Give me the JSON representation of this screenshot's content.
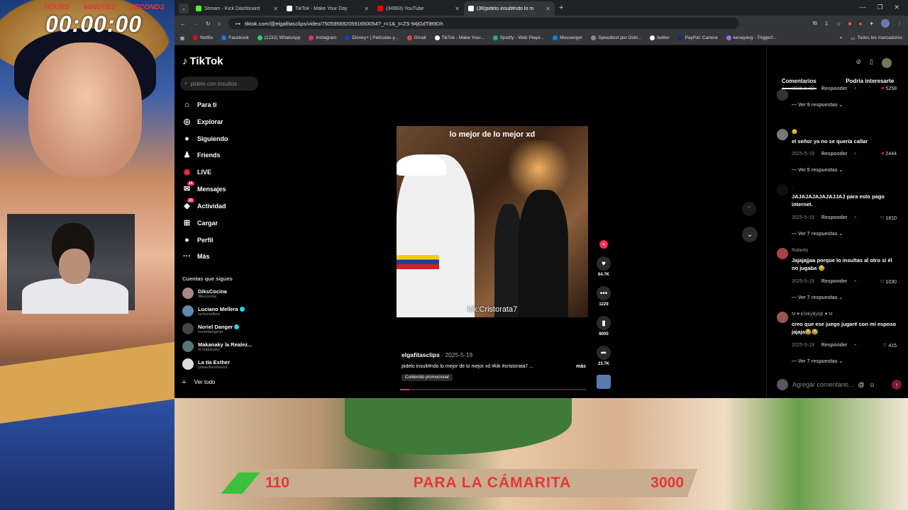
{
  "overlay": {
    "timer_labels": {
      "hours": "HOURS",
      "minutes": "MINUTES",
      "seconds": "SECONDS"
    },
    "timer": "00:00:00",
    "goal": {
      "current": "110",
      "label": "PARA LA CÁMARITA",
      "target": "3000"
    }
  },
  "browser": {
    "tabs": [
      {
        "label": "Stream - Kick Dashboard",
        "color": "#53fc18"
      },
      {
        "label": "TikTok - Make Your Day",
        "color": "#ffffff"
      },
      {
        "label": "(34993) YouTube",
        "color": "#ff0000"
      },
      {
        "label": "(38)pidelo insult#ndo lo m",
        "color": "#ffffff"
      }
    ],
    "url": "tiktok.com/@elgafitasclips/video/7505956920591650054?_r=1&_t=ZS-94jGdTiB9Dh",
    "bookmarks": [
      {
        "label": "Netflix",
        "color": "#e50914"
      },
      {
        "label": "Facebook",
        "color": "#1877f2"
      },
      {
        "label": "(1232) WhatsApp",
        "color": "#25d366"
      },
      {
        "label": "Instagram",
        "color": "#e1306c"
      },
      {
        "label": "Disney+ | Películas y...",
        "color": "#113ccf"
      },
      {
        "label": "Gmail",
        "color": "#ea4335"
      },
      {
        "label": "TikTok - Make Your...",
        "color": "#ffffff"
      },
      {
        "label": "Spotify - Web Playe...",
        "color": "#1db954"
      },
      {
        "label": "Messenger",
        "color": "#0084ff"
      },
      {
        "label": "Speedtest por Ookl...",
        "color": "#888888"
      },
      {
        "label": "twitter",
        "color": "#ffffff"
      },
      {
        "label": "PayPal: Cartera",
        "color": "#003087"
      },
      {
        "label": "kenayavg - Triggerf...",
        "color": "#aa66ff"
      }
    ],
    "all_bookmarks": "Todos los marcadores"
  },
  "tiktok": {
    "logo": "TikTok",
    "search_placeholder": "pidelo con insultos",
    "nav": [
      {
        "label": "Para ti",
        "icon": "home-icon",
        "glyph": "⌂"
      },
      {
        "label": "Explorar",
        "icon": "compass-icon",
        "glyph": "◎"
      },
      {
        "label": "Siguiendo",
        "icon": "following-icon",
        "glyph": "●"
      },
      {
        "label": "Friends",
        "icon": "friends-icon",
        "glyph": "♟"
      },
      {
        "label": "LIVE",
        "icon": "live-icon",
        "glyph": "◉"
      },
      {
        "label": "Mensajes",
        "icon": "messages-icon",
        "glyph": "✉",
        "badge": "16"
      },
      {
        "label": "Actividad",
        "icon": "activity-icon",
        "glyph": "◈",
        "badge": "23"
      },
      {
        "label": "Cargar",
        "icon": "upload-icon",
        "glyph": "⊞"
      },
      {
        "label": "Perfil",
        "icon": "profile-icon",
        "glyph": "●"
      },
      {
        "label": "Más",
        "icon": "more-icon",
        "glyph": "···"
      }
    ],
    "following_title": "Cuentas que sigues",
    "following": [
      {
        "name": "DiksCocina",
        "handle": "dikscocina",
        "verified": false,
        "color": "#a88"
      },
      {
        "name": "Luciano Mellera",
        "handle": "luchomellera",
        "verified": true,
        "color": "#68a"
      },
      {
        "name": "Noriel Danger",
        "handle": "norieldangerpr",
        "verified": true,
        "color": "#444"
      },
      {
        "name": "Makanaky la Realez...",
        "handle": "el.makanaky",
        "verified": false,
        "color": "#577"
      },
      {
        "name": "La tía Esther",
        "handle": "juliaestherflores2",
        "verified": false,
        "color": "#ddd"
      }
    ],
    "see_all": "Ver todo",
    "video": {
      "title_overlay": "lo mejor de lo mejor xd",
      "watermark": "kik:Cristorata7",
      "author": "elgafitasclips",
      "date": "· 2025-5-18",
      "description": "pidelo insult#ndo lo mejor de lo mejor xd #kik #cristorata7 ...",
      "more": "más",
      "promo": "Contenido promocional",
      "progress": 0.05
    },
    "actions": {
      "likes": "64.7K",
      "comments": "1229",
      "saves": "8000",
      "shares": "23.7K"
    },
    "comments_tabs": [
      "Comentarios",
      "Podría interesarte"
    ],
    "comments": [
      {
        "user": "",
        "text": "",
        "date": "2025-5-19",
        "reply": "Responder",
        "likes": "5258",
        "more": "Ver 9 respuestas ⌄",
        "avatar": "#333"
      },
      {
        "user": "😊 ·",
        "text": "el señor ya no se quería callar",
        "date": "2025-5-19",
        "reply": "Responder",
        "likes": "2444",
        "more": "Ver 5 respuestas ⌄",
        "avatar": "#777"
      },
      {
        "user": ".",
        "text": "JAJAJAJAJAJAJJAJ para esto pago internet.",
        "date": "2025-5-19",
        "reply": "Responder",
        "likes": "1810",
        "more": "Ver 7 respuestas ⌄",
        "avatar": "#111"
      },
      {
        "user": "Roberto",
        "text": "Jajajajjaa porque lo insultas al otro si él no jugaba 😂",
        "date": "2025-5-19",
        "reply": "Responder",
        "likes": "1030",
        "more": "Ver 7 respuestas ⌄",
        "avatar": "#a44"
      },
      {
        "user": "M ♥ €St€y$yt@ ♥ M",
        "text": "creo que ese juego jugaré con mi esposo jajaja😂😂",
        "date": "2025-5-19",
        "reply": "Responder",
        "likes": "415",
        "more": "Ver 7 respuestas ⌄",
        "avatar": "#955"
      }
    ],
    "comment_placeholder": "Agregar comentario..."
  }
}
